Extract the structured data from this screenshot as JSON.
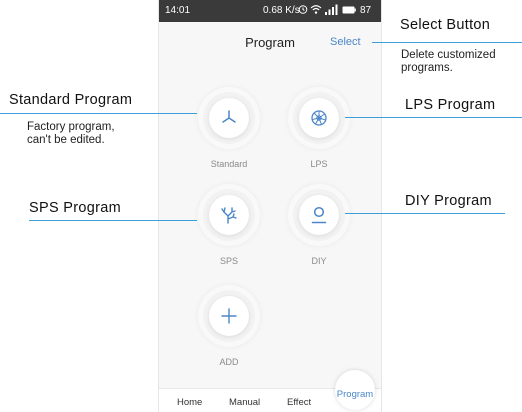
{
  "status_bar": {
    "time": "14:01",
    "network_rate": "0.68 K/s",
    "battery": "87"
  },
  "app": {
    "title": "Program",
    "select_label": "Select"
  },
  "programs": [
    {
      "label": "Standard",
      "icon": "standard-icon"
    },
    {
      "label": "LPS",
      "icon": "shell-icon"
    },
    {
      "label": "SPS",
      "icon": "coral-icon"
    },
    {
      "label": "DIY",
      "icon": "user-icon"
    },
    {
      "label": "ADD",
      "icon": "plus-icon"
    }
  ],
  "bottom_nav": {
    "home": "Home",
    "manual": "Manual",
    "effect": "Effect",
    "program": "Program"
  },
  "annotations": {
    "select_button": {
      "title": "Select Button",
      "desc_line1": "Delete customized",
      "desc_line2": "programs."
    },
    "standard_program": {
      "title": "Standard Program",
      "desc_line1": "Factory program,",
      "desc_line2": "can't be edited."
    },
    "lps_program": {
      "title": "LPS Program"
    },
    "sps_program": {
      "title": "SPS Program"
    },
    "diy_program": {
      "title": "DIY Program"
    }
  },
  "colors": {
    "accent": "#4b86c8",
    "status_bar": "#3a3a3a",
    "annotation_line": "#3aa0d8"
  }
}
